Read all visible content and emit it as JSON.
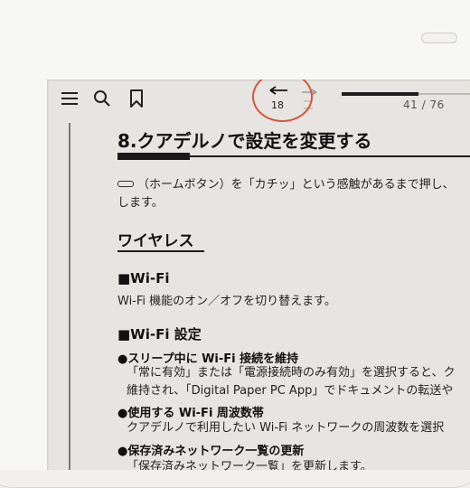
{
  "toolbar": {
    "back_page": "18",
    "progress_fraction": 0.6,
    "page_indicator": "41 / 76"
  },
  "document": {
    "chapter_title": "8.クアデルノで設定を変更する",
    "intro_line1": "（ホームボタン）を「カチッ」という感触があるまで押し、",
    "intro_line2": "します。",
    "section_title": "ワイヤレス",
    "wifi_heading": "■Wi-Fi",
    "wifi_desc": "Wi-Fi 機能のオン／オフを切り替えます。",
    "wifi_settings_heading": "■Wi-Fi 設定",
    "items": [
      {
        "heading": "●スリープ中に Wi-Fi 接続を維持",
        "lines": [
          "「常に有効」または「電源接続時のみ有効」を選択すると、ク",
          "維持され、「Digital Paper PC App」でドキュメントの転送や"
        ]
      },
      {
        "heading": "●使用する Wi-Fi 周波数帯",
        "lines": [
          "クアデルノで利用したい Wi-Fi ネットワークの周波数を選択"
        ]
      },
      {
        "heading": "●保存済みネットワーク一覧の更新",
        "lines": [
          "「保存済みネットワーク一覧」を更新します。"
        ]
      }
    ]
  },
  "colors": {
    "annotation_circle": "#d9533e",
    "screen": "#e7e5e1",
    "ink": "#1a1a1a"
  },
  "icons": [
    "menu-icon",
    "search-icon",
    "bookmark-icon",
    "back-arrow-icon",
    "forward-arrow-icon",
    "home-button-icon"
  ]
}
